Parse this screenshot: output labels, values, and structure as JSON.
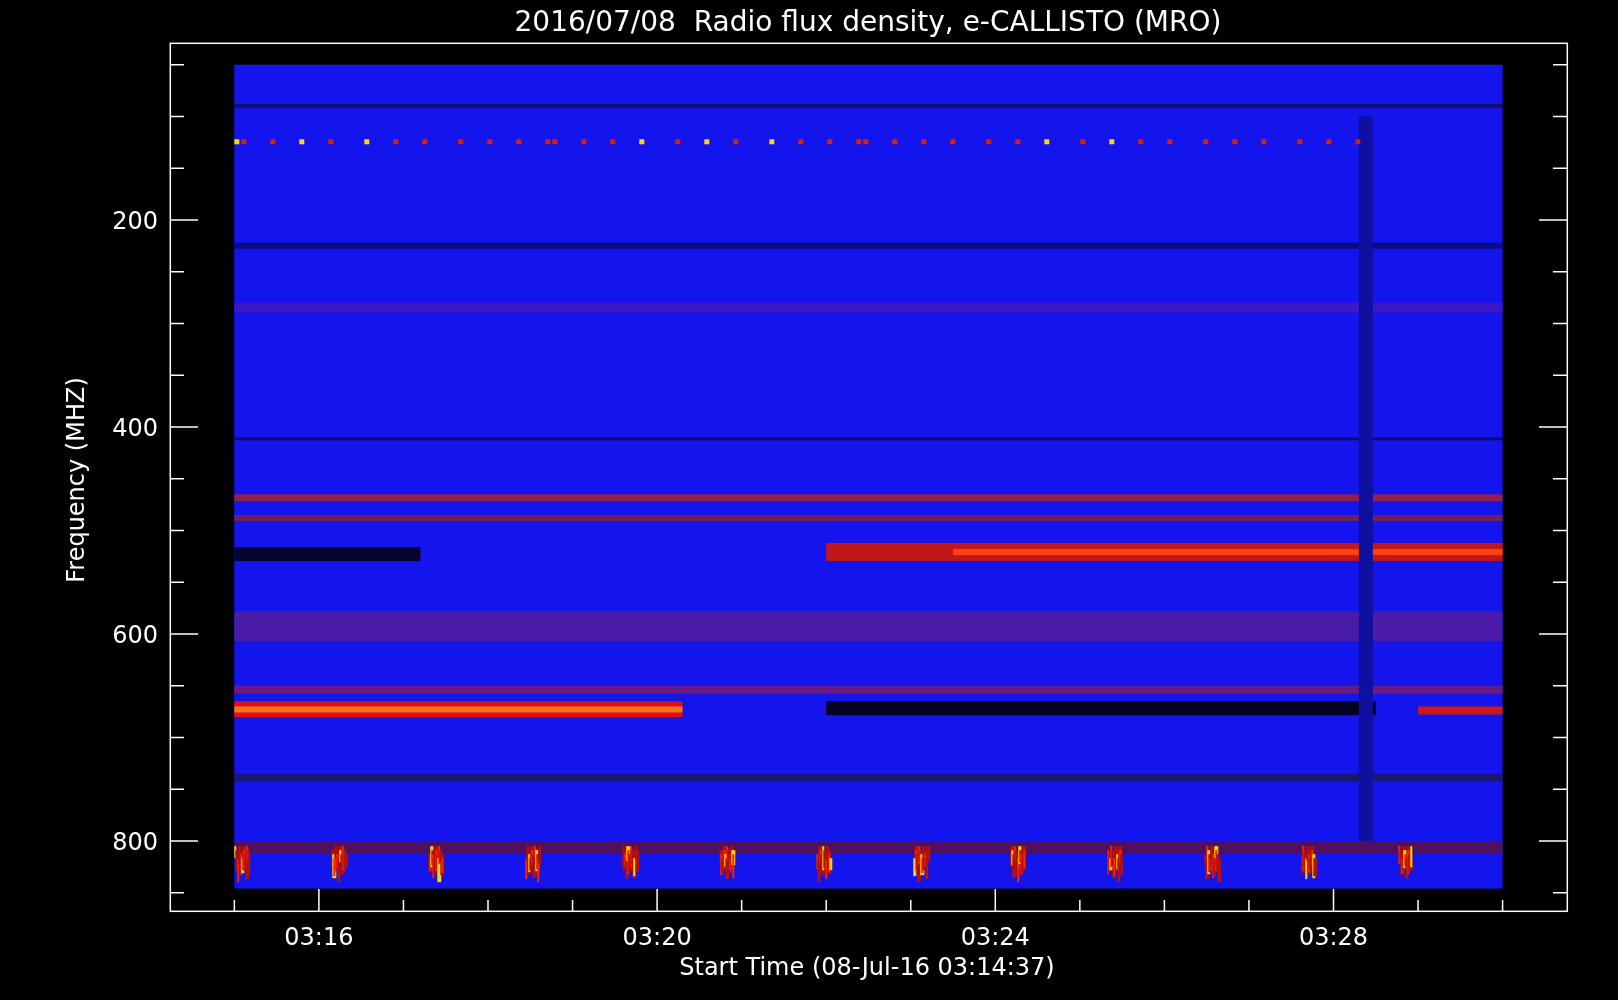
{
  "title": "2016/07/08  Radio flux density, e-CALLISTO (MRO)",
  "y_axis": {
    "label": "Frequency (MHZ)",
    "ticks": [
      "200",
      "400",
      "600",
      "800"
    ]
  },
  "x_axis": {
    "label": "Start Time (08-Jul-16 03:14:37)",
    "ticks": [
      "03:16",
      "03:20",
      "03:24",
      "03:28"
    ]
  }
}
